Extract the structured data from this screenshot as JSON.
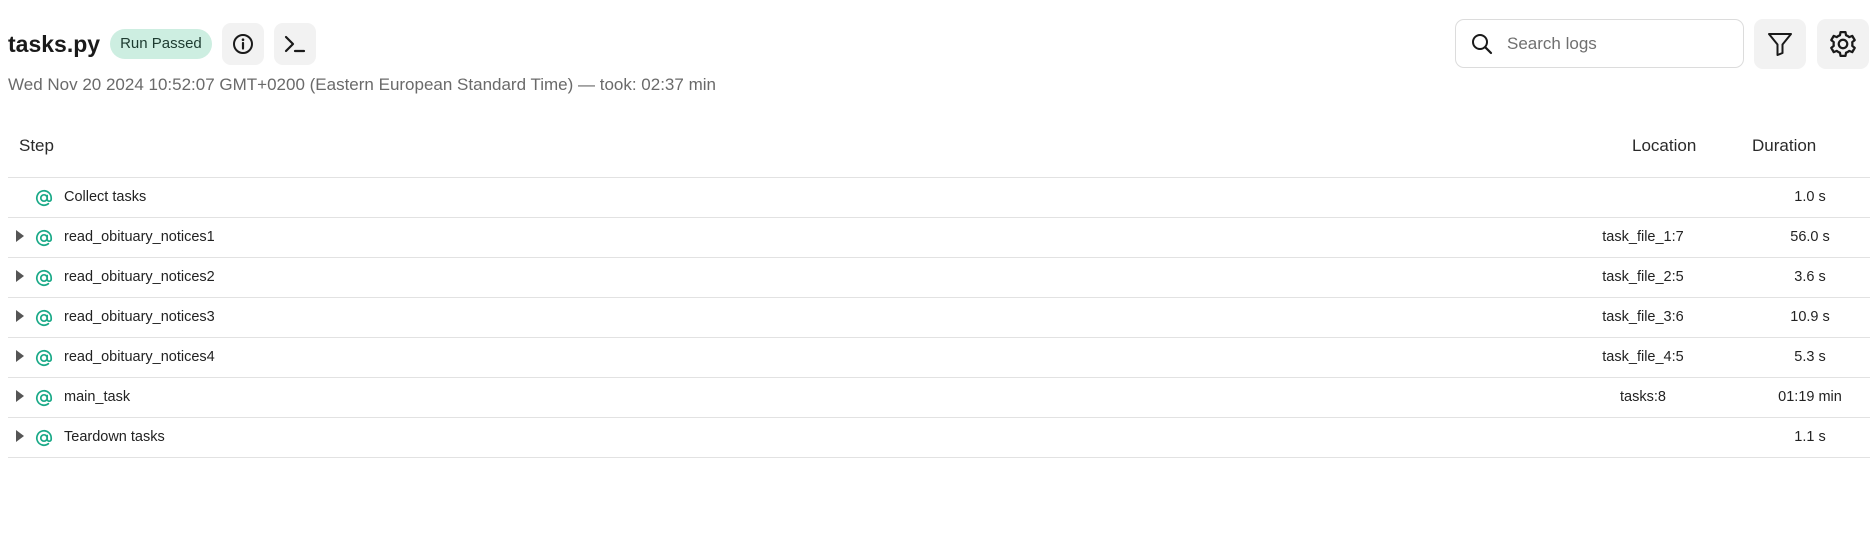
{
  "header": {
    "title": "tasks.py",
    "status_badge": "Run Passed",
    "subtitle": "Wed Nov 20 2024 10:52:07 GMT+0200 (Eastern European Standard Time) — took: 02:37 min",
    "info_icon": "info-icon",
    "console_icon": "terminal-icon"
  },
  "search": {
    "placeholder": "Search logs",
    "value": "",
    "icon": "search-icon"
  },
  "toolbar": {
    "filter_icon": "filter-icon",
    "settings_icon": "gear-icon"
  },
  "table": {
    "columns": {
      "step": "Step",
      "location": "Location",
      "duration": "Duration"
    },
    "rows": [
      {
        "name": "Collect tasks",
        "location": "",
        "duration": "1.0 s",
        "expandable": false
      },
      {
        "name": "read_obituary_notices1",
        "location": "task_file_1:7",
        "duration": "56.0 s",
        "expandable": true
      },
      {
        "name": "read_obituary_notices2",
        "location": "task_file_2:5",
        "duration": "3.6 s",
        "expandable": true
      },
      {
        "name": "read_obituary_notices3",
        "location": "task_file_3:6",
        "duration": "10.9 s",
        "expandable": true
      },
      {
        "name": "read_obituary_notices4",
        "location": "task_file_4:5",
        "duration": "5.3 s",
        "expandable": true
      },
      {
        "name": "main_task",
        "location": "tasks:8",
        "duration": "01:19 min",
        "expandable": true
      },
      {
        "name": "Teardown tasks",
        "location": "",
        "duration": "1.1 s",
        "expandable": true
      }
    ]
  },
  "colors": {
    "accent": "#19a987",
    "badge_bg": "#cdeee1",
    "button_bg": "#f2f2f2"
  }
}
